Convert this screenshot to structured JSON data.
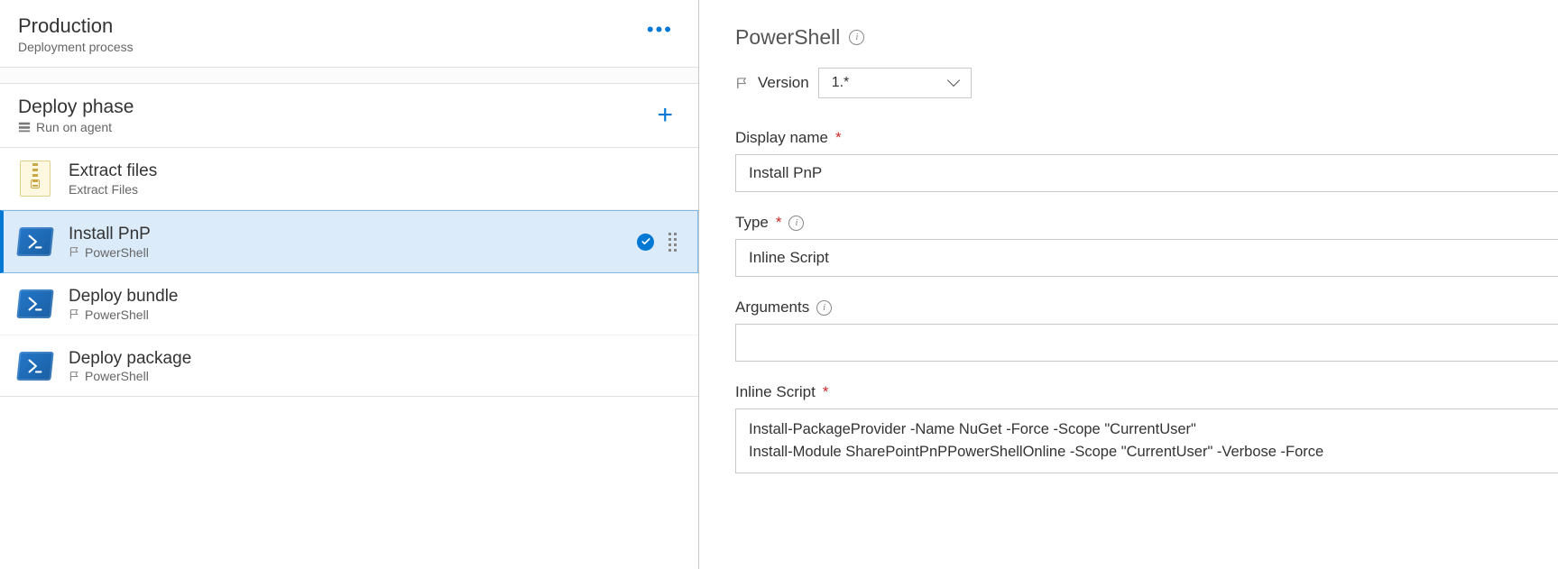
{
  "stage": {
    "title": "Production",
    "subtitle": "Deployment process"
  },
  "phase": {
    "title": "Deploy phase",
    "run_on": "Run on agent"
  },
  "tasks": [
    {
      "name": "Extract files",
      "type": "Extract Files",
      "icon": "zip",
      "selected": false
    },
    {
      "name": "Install PnP",
      "type": "PowerShell",
      "icon": "ps",
      "selected": true
    },
    {
      "name": "Deploy bundle",
      "type": "PowerShell",
      "icon": "ps",
      "selected": false
    },
    {
      "name": "Deploy package",
      "type": "PowerShell",
      "icon": "ps",
      "selected": false
    }
  ],
  "panel": {
    "title": "PowerShell",
    "version_label": "Version",
    "version_value": "1.*",
    "fields": {
      "display_name": {
        "label": "Display name",
        "required": true,
        "value": "Install PnP"
      },
      "type": {
        "label": "Type",
        "required": true,
        "value": "Inline Script",
        "has_info": true
      },
      "arguments": {
        "label": "Arguments",
        "required": false,
        "value": "",
        "has_info": true
      },
      "inline_script": {
        "label": "Inline Script",
        "required": true,
        "value": "Install-PackageProvider -Name NuGet -Force -Scope \"CurrentUser\"\nInstall-Module SharePointPnPPowerShellOnline -Scope \"CurrentUser\" -Verbose -Force"
      }
    }
  }
}
